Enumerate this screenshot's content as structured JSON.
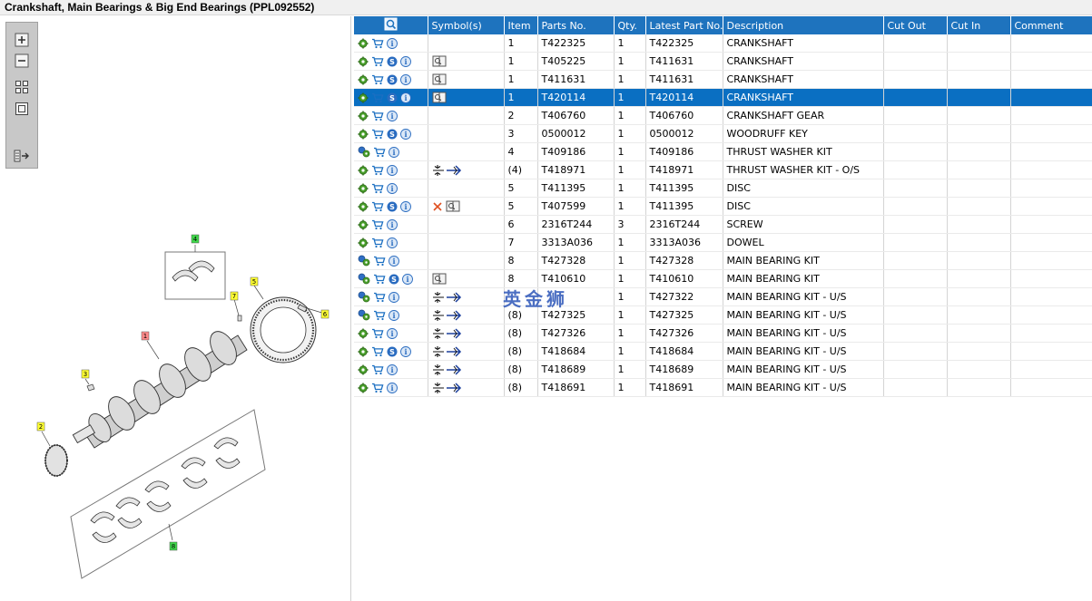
{
  "window": {
    "title": "Crankshaft, Main Bearings & Big End Bearings (PPL092552)"
  },
  "toolbox": {
    "buttons": [
      "zoom-in-icon",
      "zoom-out-icon",
      "fit-all-icon",
      "actual-size-icon",
      "export-icon"
    ]
  },
  "diagram": {
    "callouts": [
      "4",
      "7",
      "5",
      "6",
      "1",
      "3",
      "2",
      "8"
    ]
  },
  "table": {
    "headers": [
      "",
      "Symbol(s)",
      "Item",
      "Parts No.",
      "Qty.",
      "Latest Part No.",
      "Description",
      "Cut Out",
      "Cut In",
      "Comment"
    ],
    "rows": [
      {
        "item": "1",
        "part": "T422325",
        "qty": "1",
        "latest": "T422325",
        "desc": "CRANKSHAFT",
        "s": false,
        "book": false,
        "sym": "",
        "gear2": false
      },
      {
        "item": "1",
        "part": "T405225",
        "qty": "1",
        "latest": "T411631",
        "desc": "CRANKSHAFT",
        "s": true,
        "book": true,
        "sym": "",
        "gear2": false
      },
      {
        "item": "1",
        "part": "T411631",
        "qty": "1",
        "latest": "T411631",
        "desc": "CRANKSHAFT",
        "s": true,
        "book": true,
        "sym": "",
        "gear2": false
      },
      {
        "item": "1",
        "part": "T420114",
        "qty": "1",
        "latest": "T420114",
        "desc": "CRANKSHAFT",
        "s": true,
        "book": true,
        "sym": "",
        "gear2": false,
        "selected": true
      },
      {
        "item": "2",
        "part": "T406760",
        "qty": "1",
        "latest": "T406760",
        "desc": "CRANKSHAFT GEAR",
        "s": false,
        "book": false,
        "sym": "",
        "gear2": false
      },
      {
        "item": "3",
        "part": "0500012",
        "qty": "1",
        "latest": "0500012",
        "desc": "WOODRUFF KEY",
        "s": true,
        "book": false,
        "sym": "",
        "gear2": false
      },
      {
        "item": "4",
        "part": "T409186",
        "qty": "1",
        "latest": "T409186",
        "desc": "THRUST WASHER KIT",
        "s": false,
        "book": false,
        "sym": "",
        "gear2": true
      },
      {
        "item": "(4)",
        "part": "T418971",
        "qty": "1",
        "latest": "T418971",
        "desc": "THRUST WASHER KIT - O/S",
        "s": false,
        "book": false,
        "sym": "kit",
        "gear2": false
      },
      {
        "item": "5",
        "part": "T411395",
        "qty": "1",
        "latest": "T411395",
        "desc": "DISC",
        "s": false,
        "book": false,
        "sym": "",
        "gear2": false
      },
      {
        "item": "5",
        "part": "T407599",
        "qty": "1",
        "latest": "T411395",
        "desc": "DISC",
        "s": true,
        "book": true,
        "sym": "cross",
        "gear2": false
      },
      {
        "item": "6",
        "part": "2316T244",
        "qty": "3",
        "latest": "2316T244",
        "desc": "SCREW",
        "s": false,
        "book": false,
        "sym": "",
        "gear2": false
      },
      {
        "item": "7",
        "part": "3313A036",
        "qty": "1",
        "latest": "3313A036",
        "desc": "DOWEL",
        "s": false,
        "book": false,
        "sym": "",
        "gear2": false
      },
      {
        "item": "8",
        "part": "T427328",
        "qty": "1",
        "latest": "T427328",
        "desc": "MAIN BEARING KIT",
        "s": false,
        "book": false,
        "sym": "",
        "gear2": true
      },
      {
        "item": "8",
        "part": "T410610",
        "qty": "1",
        "latest": "T410610",
        "desc": "MAIN BEARING KIT",
        "s": true,
        "book": true,
        "sym": "",
        "gear2": true
      },
      {
        "item": "",
        "part": "",
        "qty": "1",
        "latest": "T427322",
        "desc": "MAIN BEARING KIT - U/S",
        "s": false,
        "book": false,
        "sym": "kit",
        "gear2": true
      },
      {
        "item": "(8)",
        "part": "T427325",
        "qty": "1",
        "latest": "T427325",
        "desc": "MAIN BEARING KIT - U/S",
        "s": false,
        "book": false,
        "sym": "kit",
        "gear2": true
      },
      {
        "item": "(8)",
        "part": "T427326",
        "qty": "1",
        "latest": "T427326",
        "desc": "MAIN BEARING KIT - U/S",
        "s": false,
        "book": false,
        "sym": "kit",
        "gear2": false
      },
      {
        "item": "(8)",
        "part": "T418684",
        "qty": "1",
        "latest": "T418684",
        "desc": "MAIN BEARING KIT - U/S",
        "s": true,
        "book": false,
        "sym": "kit",
        "gear2": false
      },
      {
        "item": "(8)",
        "part": "T418689",
        "qty": "1",
        "latest": "T418689",
        "desc": "MAIN BEARING KIT - U/S",
        "s": false,
        "book": false,
        "sym": "kit",
        "gear2": false
      },
      {
        "item": "(8)",
        "part": "T418691",
        "qty": "1",
        "latest": "T418691",
        "desc": "MAIN BEARING KIT - U/S",
        "s": false,
        "book": false,
        "sym": "kit",
        "gear2": false
      }
    ]
  },
  "watermark": "英金狮",
  "colors": {
    "header": "#1e73be",
    "selected": "#0a6fc2",
    "toolbox": "#c8c8c8"
  }
}
